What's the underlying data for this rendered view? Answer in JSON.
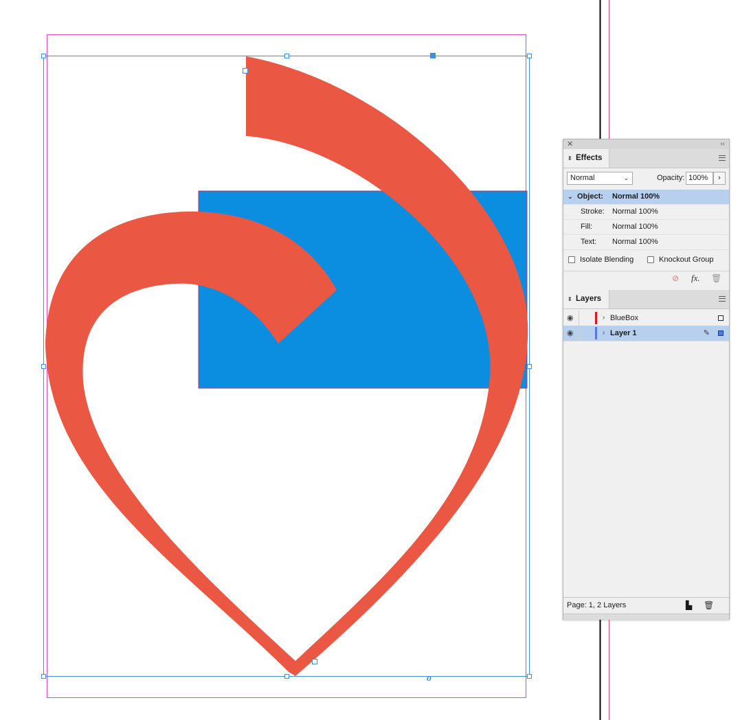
{
  "app": {
    "accent": "#3a8fe0",
    "shape_color": "#ea5743",
    "box_color": "#0b8ee0"
  },
  "effects_panel": {
    "tab_label": "Effects",
    "blend_mode": "Normal",
    "opacity_label": "Opacity:",
    "opacity_value": "100%",
    "rows": [
      {
        "label": "Object:",
        "value": "Normal 100%",
        "selected": true
      },
      {
        "label": "Stroke:",
        "value": "Normal 100%",
        "selected": false
      },
      {
        "label": "Fill:",
        "value": "Normal 100%",
        "selected": false
      },
      {
        "label": "Text:",
        "value": "Normal 100%",
        "selected": false
      }
    ],
    "isolate_blending": "Isolate Blending",
    "knockout_group": "Knockout Group",
    "fx_label": "fx."
  },
  "layers_panel": {
    "tab_label": "Layers",
    "layers": [
      {
        "name": "BlueBox",
        "color": "#e0151e",
        "selected": false
      },
      {
        "name": "Layer 1",
        "color": "#4f7be0",
        "selected": true
      }
    ],
    "footer": "Page: 1, 2 Layers"
  },
  "icons": {
    "close": "close-icon",
    "collapse": "collapse-icon",
    "menu": "panel-menu-icon",
    "eye": "eye-icon",
    "pen": "pen-icon",
    "new_layer": "new-layer-icon",
    "trash": "trash-icon",
    "clear_effects": "clear-effects-icon"
  },
  "canvas": {
    "transform_marker": "o"
  }
}
